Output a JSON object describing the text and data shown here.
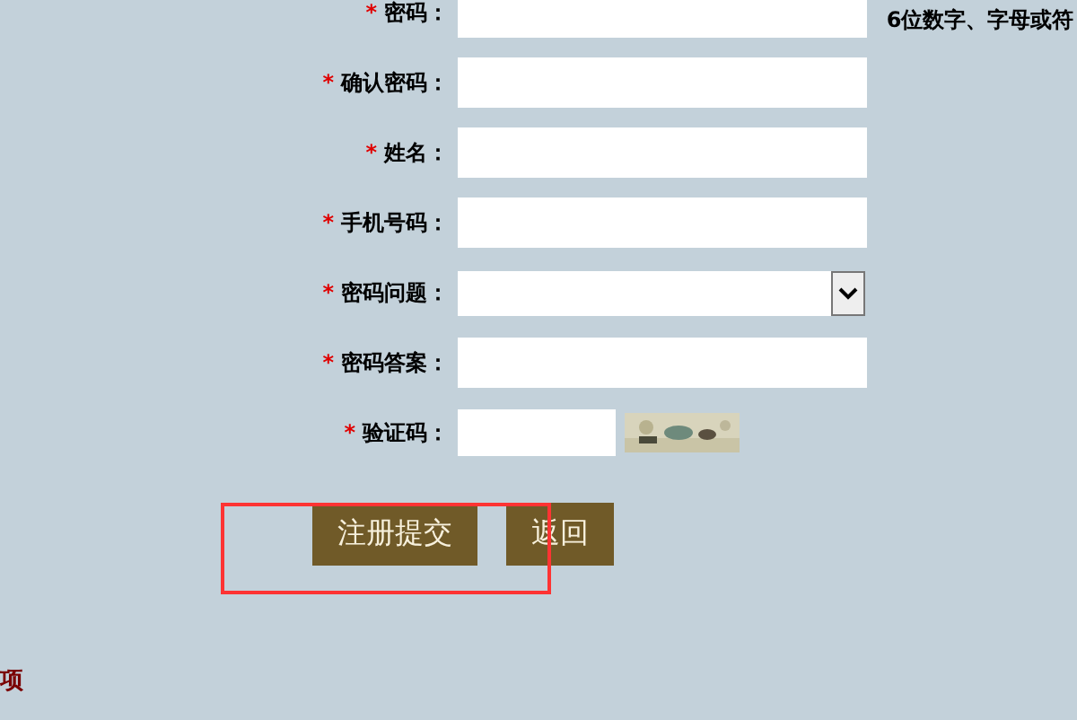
{
  "form": {
    "rows": [
      {
        "kind": "text",
        "required_mark": "*",
        "label": "密码：",
        "hint": "6位数字、字母或符"
      },
      {
        "kind": "text",
        "required_mark": "*",
        "label": "确认密码："
      },
      {
        "kind": "text",
        "required_mark": "*",
        "label": "姓名："
      },
      {
        "kind": "text",
        "required_mark": "*",
        "label": "手机号码："
      },
      {
        "kind": "select",
        "required_mark": "*",
        "label": "密码问题："
      },
      {
        "kind": "text",
        "required_mark": "*",
        "label": "密码答案："
      },
      {
        "kind": "captcha",
        "required_mark": "*",
        "label": "验证码："
      }
    ],
    "buttons": [
      "注册提交",
      "返回"
    ],
    "highlight": {
      "shown": true
    }
  },
  "notes": {
    "heading": "项"
  }
}
